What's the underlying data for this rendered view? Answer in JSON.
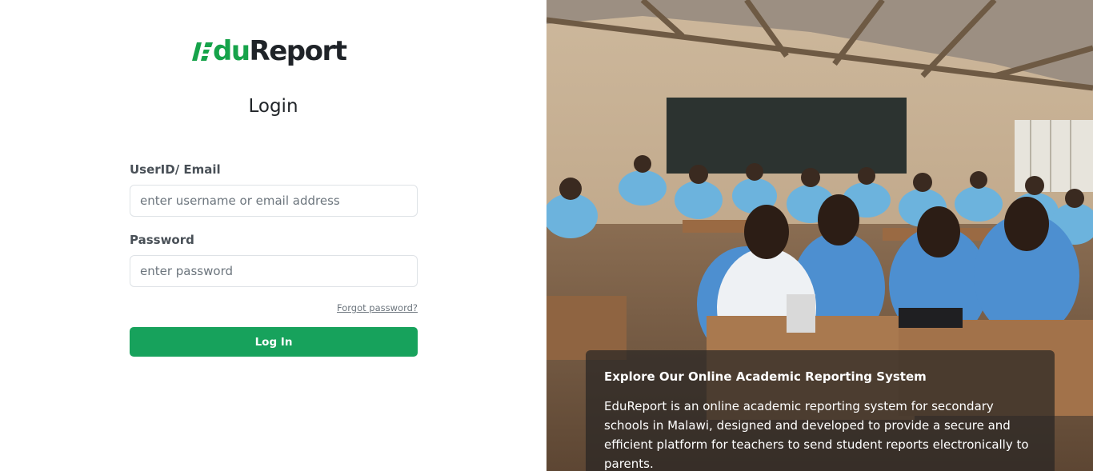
{
  "brand": {
    "name_part1": "du",
    "name_part2": "Report",
    "mark_letter": "E",
    "accent_color": "#16a34a",
    "dark_color": "#1f2328"
  },
  "login": {
    "title": "Login",
    "user_label": "UserID/ Email",
    "user_placeholder": "enter username or email address",
    "user_value": "",
    "password_label": "Password",
    "password_placeholder": "enter password",
    "password_value": "",
    "forgot_link": "Forgot password?",
    "submit_label": "Log In",
    "button_color": "#17a25c"
  },
  "hero": {
    "image_subject": "classroom-students-photo",
    "caption_title": "Explore Our Online Academic Reporting System",
    "caption_body": "EduReport is an online academic reporting system for secondary schools in Malawi, designed and developed to provide a secure and efficient platform for teachers to send student reports electronically to parents."
  }
}
